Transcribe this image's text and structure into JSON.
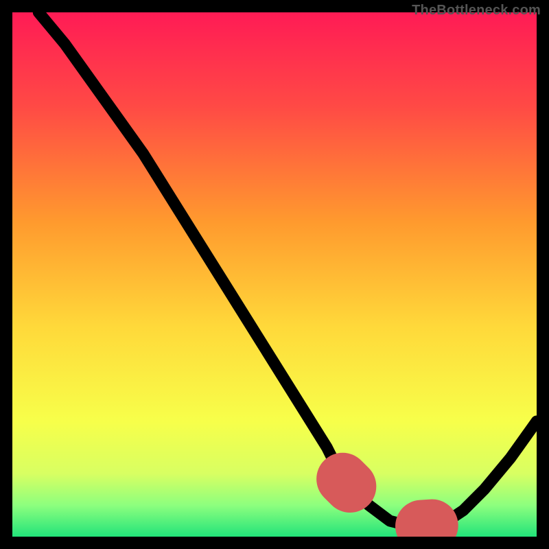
{
  "watermark": "TheBottleneck.com",
  "colors": {
    "gradient_stops": [
      {
        "offset": 0.0,
        "color": "#ff1b55"
      },
      {
        "offset": 0.18,
        "color": "#ff4a45"
      },
      {
        "offset": 0.4,
        "color": "#ff9a2e"
      },
      {
        "offset": 0.6,
        "color": "#ffd93a"
      },
      {
        "offset": 0.78,
        "color": "#f7ff4a"
      },
      {
        "offset": 0.88,
        "color": "#d8ff62"
      },
      {
        "offset": 0.94,
        "color": "#8dff7e"
      },
      {
        "offset": 1.0,
        "color": "#22e37a"
      }
    ],
    "curve": "#000000",
    "highlight": "#d75a5a",
    "background": "#000000"
  },
  "chart_data": {
    "type": "line",
    "title": "",
    "xlabel": "",
    "ylabel": "",
    "xlim": [
      0,
      100
    ],
    "ylim": [
      0,
      100
    ],
    "grid": false,
    "legend": false,
    "series": [
      {
        "name": "bottleneck-curve",
        "x": [
          5,
          10,
          15,
          20,
          25,
          30,
          35,
          40,
          45,
          50,
          55,
          60,
          62,
          65,
          68,
          72,
          76,
          80,
          83,
          86,
          90,
          95,
          100
        ],
        "y": [
          100,
          94,
          87,
          80,
          73,
          65,
          57,
          49,
          41,
          33,
          25,
          17,
          13,
          9,
          6,
          3,
          2,
          2,
          3,
          5,
          9,
          15,
          22
        ]
      }
    ],
    "annotations": [
      {
        "name": "optimal-zone",
        "style": "dotted-highlight",
        "x": [
          63,
          66,
          69,
          72,
          75,
          78,
          81,
          83,
          85
        ],
        "y": [
          11,
          8,
          5.5,
          3.5,
          2.5,
          2,
          2.2,
          3,
          4.2
        ]
      }
    ]
  }
}
